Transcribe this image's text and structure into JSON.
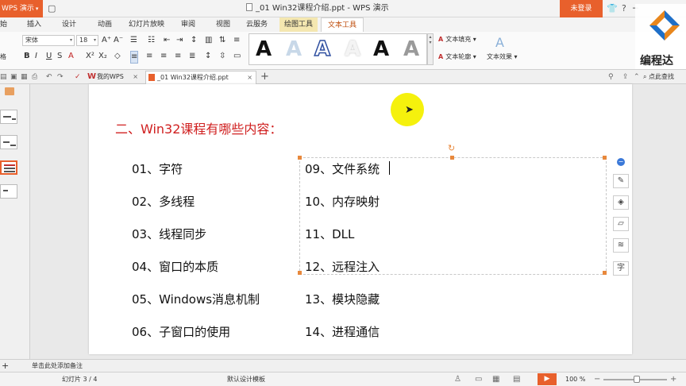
{
  "app": {
    "menu_label": "WPS 演示",
    "window_title": "_01 Win32课程介绍.ppt - WPS 演示",
    "login_label": "未登录",
    "accent_color": "#e8602c"
  },
  "ribbon_tabs": [
    {
      "label": "始"
    },
    {
      "label": "插入"
    },
    {
      "label": "设计"
    },
    {
      "label": "动画"
    },
    {
      "label": "幻灯片放映"
    },
    {
      "label": "审阅"
    },
    {
      "label": "视图"
    },
    {
      "label": "云服务"
    },
    {
      "label": "绘图工具"
    },
    {
      "label": "文本工具"
    }
  ],
  "ribbon": {
    "font_name": "宋体",
    "font_size": "18",
    "text_fill_label": "文本填充",
    "text_outline_label": "文本轮廓",
    "text_effect_label": "文本效果",
    "left_cut_label": "格"
  },
  "doc_tabs": {
    "mywps_label": "我的WPS",
    "ppt_label": "_01 Win32课程介绍.ppt",
    "search_label": "点此查找"
  },
  "slide": {
    "heading": "二、Win32课程有哪些内容：",
    "left_items": [
      "01、字符",
      "02、多线程",
      "03、线程同步",
      "04、窗口的本质",
      "05、Windows消息机制",
      "06、子窗口的使用"
    ],
    "right_items": [
      "09、文件系统",
      "10、内存映射",
      "11、DLL",
      "12、远程注入",
      "13、模块隐藏",
      "14、进程通信"
    ]
  },
  "notes": {
    "placeholder": "单击此处添加备注"
  },
  "status": {
    "slide_count": "幻灯片 3 / 4",
    "template": "默认设计模板",
    "zoom": "100 %"
  },
  "watermark": {
    "text": "编程达"
  }
}
